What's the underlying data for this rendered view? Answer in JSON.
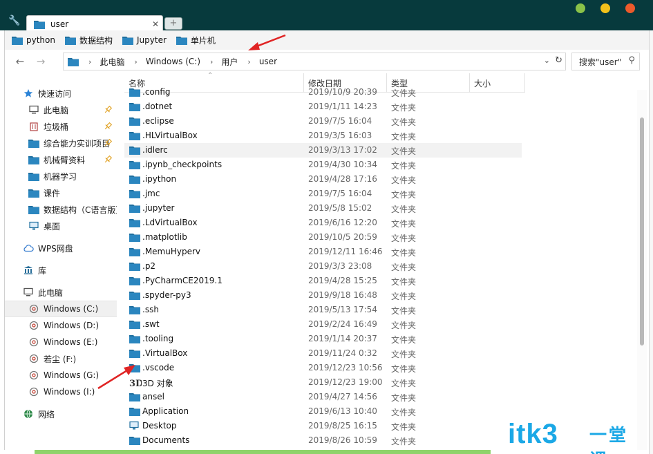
{
  "window": {
    "tab_title": "user",
    "tab_close": "✕",
    "new_tab": "+"
  },
  "bookmarks": [
    {
      "label": "python"
    },
    {
      "label": "数据结构"
    },
    {
      "label": "Jupyter"
    },
    {
      "label": "单片机"
    }
  ],
  "nav": {
    "back": "←",
    "forward": "→",
    "breadcrumbs": [
      "此电脑",
      "Windows (C:)",
      "用户",
      "user"
    ],
    "search_placeholder": "搜索\"user\""
  },
  "nav_pane": [
    {
      "label": "快速访问",
      "icon": "star-icon",
      "pinned": false
    },
    {
      "label": "此电脑",
      "icon": "monitor-icon",
      "pinned": true
    },
    {
      "label": "垃圾桶",
      "icon": "trash-icon",
      "pinned": true
    },
    {
      "label": "综合能力实训项目",
      "icon": "folder-icon",
      "pinned": true
    },
    {
      "label": "机械臂资料",
      "icon": "folder-icon",
      "pinned": true
    },
    {
      "label": "机器学习",
      "icon": "folder-icon",
      "pinned": false
    },
    {
      "label": "课件",
      "icon": "folder-icon",
      "pinned": false
    },
    {
      "label": "数据结构（C语言版）",
      "icon": "folder-icon",
      "pinned": false
    },
    {
      "label": "桌面",
      "icon": "desktop-icon",
      "pinned": false
    },
    {
      "label": "WPS网盘",
      "icon": "cloud-icon",
      "pinned": false
    },
    {
      "label": "库",
      "icon": "library-icon",
      "pinned": false
    },
    {
      "label": "此电脑",
      "icon": "monitor-icon",
      "pinned": false
    },
    {
      "label": "Windows (C:)",
      "icon": "drive-icon",
      "pinned": false,
      "selected": true
    },
    {
      "label": "Windows (D:)",
      "icon": "drive-icon",
      "pinned": false
    },
    {
      "label": "Windows (E:)",
      "icon": "drive-icon",
      "pinned": false
    },
    {
      "label": "若尘 (F:)",
      "icon": "drive-icon",
      "pinned": false
    },
    {
      "label": "Windows (G:)",
      "icon": "drive-icon",
      "pinned": false
    },
    {
      "label": "Windows (I:)",
      "icon": "drive-icon",
      "pinned": false
    },
    {
      "label": "网络",
      "icon": "network-icon",
      "pinned": false
    }
  ],
  "columns": {
    "name": "名称",
    "date": "修改日期",
    "type": "类型",
    "size": "大小"
  },
  "files": [
    {
      "name": ".config",
      "date": "2019/10/9 20:39",
      "type": "文件夹",
      "icon": "folder-icon"
    },
    {
      "name": ".dotnet",
      "date": "2019/1/11 14:23",
      "type": "文件夹",
      "icon": "folder-icon"
    },
    {
      "name": ".eclipse",
      "date": "2019/7/5 16:04",
      "type": "文件夹",
      "icon": "folder-icon"
    },
    {
      "name": ".HLVirtualBox",
      "date": "2019/3/5 16:03",
      "type": "文件夹",
      "icon": "folder-icon"
    },
    {
      "name": ".idlerc",
      "date": "2019/3/13 17:02",
      "type": "文件夹",
      "icon": "folder-icon",
      "hover": true
    },
    {
      "name": ".ipynb_checkpoints",
      "date": "2019/4/30 10:34",
      "type": "文件夹",
      "icon": "folder-icon"
    },
    {
      "name": ".ipython",
      "date": "2019/4/28 17:16",
      "type": "文件夹",
      "icon": "folder-icon"
    },
    {
      "name": ".jmc",
      "date": "2019/7/5 16:04",
      "type": "文件夹",
      "icon": "folder-icon"
    },
    {
      "name": ".jupyter",
      "date": "2019/5/8 15:02",
      "type": "文件夹",
      "icon": "folder-icon"
    },
    {
      "name": ".LdVirtualBox",
      "date": "2019/6/16 12:20",
      "type": "文件夹",
      "icon": "folder-icon"
    },
    {
      "name": ".matplotlib",
      "date": "2019/10/5 20:59",
      "type": "文件夹",
      "icon": "folder-icon"
    },
    {
      "name": ".MemuHyperv",
      "date": "2019/12/11 16:46",
      "type": "文件夹",
      "icon": "folder-icon"
    },
    {
      "name": ".p2",
      "date": "2019/3/3 23:08",
      "type": "文件夹",
      "icon": "folder-icon"
    },
    {
      "name": ".PyCharmCE2019.1",
      "date": "2019/4/28 15:25",
      "type": "文件夹",
      "icon": "folder-icon"
    },
    {
      "name": ".spyder-py3",
      "date": "2019/9/18 16:48",
      "type": "文件夹",
      "icon": "folder-icon"
    },
    {
      "name": ".ssh",
      "date": "2019/5/13 17:54",
      "type": "文件夹",
      "icon": "folder-icon"
    },
    {
      "name": ".swt",
      "date": "2019/2/24 16:49",
      "type": "文件夹",
      "icon": "folder-icon"
    },
    {
      "name": ".tooling",
      "date": "2019/1/14 20:37",
      "type": "文件夹",
      "icon": "folder-icon"
    },
    {
      "name": ".VirtualBox",
      "date": "2019/11/24 0:32",
      "type": "文件夹",
      "icon": "folder-icon"
    },
    {
      "name": ".vscode",
      "date": "2019/12/23 10:56",
      "type": "文件夹",
      "icon": "folder-icon"
    },
    {
      "name": "3D 对象",
      "date": "2019/12/23 19:00",
      "type": "文件夹",
      "icon": "3d-objects-icon"
    },
    {
      "name": "ansel",
      "date": "2019/4/27 14:56",
      "type": "文件夹",
      "icon": "folder-icon"
    },
    {
      "name": "Application",
      "date": "2019/6/13 10:40",
      "type": "文件夹",
      "icon": "folder-icon"
    },
    {
      "name": "Desktop",
      "date": "2019/8/25 16:15",
      "type": "文件夹",
      "icon": "desktop-icon"
    },
    {
      "name": "Documents",
      "date": "2019/8/26 10:59",
      "type": "文件夹",
      "icon": "folder-icon"
    }
  ],
  "watermark": {
    "brand": "itk3",
    "cn": "一堂课"
  },
  "colors": {
    "titlebar": "#073a3d",
    "folder": "#1f6f9f",
    "arrow": "#e02424",
    "watermark": "#1ba8e6"
  }
}
